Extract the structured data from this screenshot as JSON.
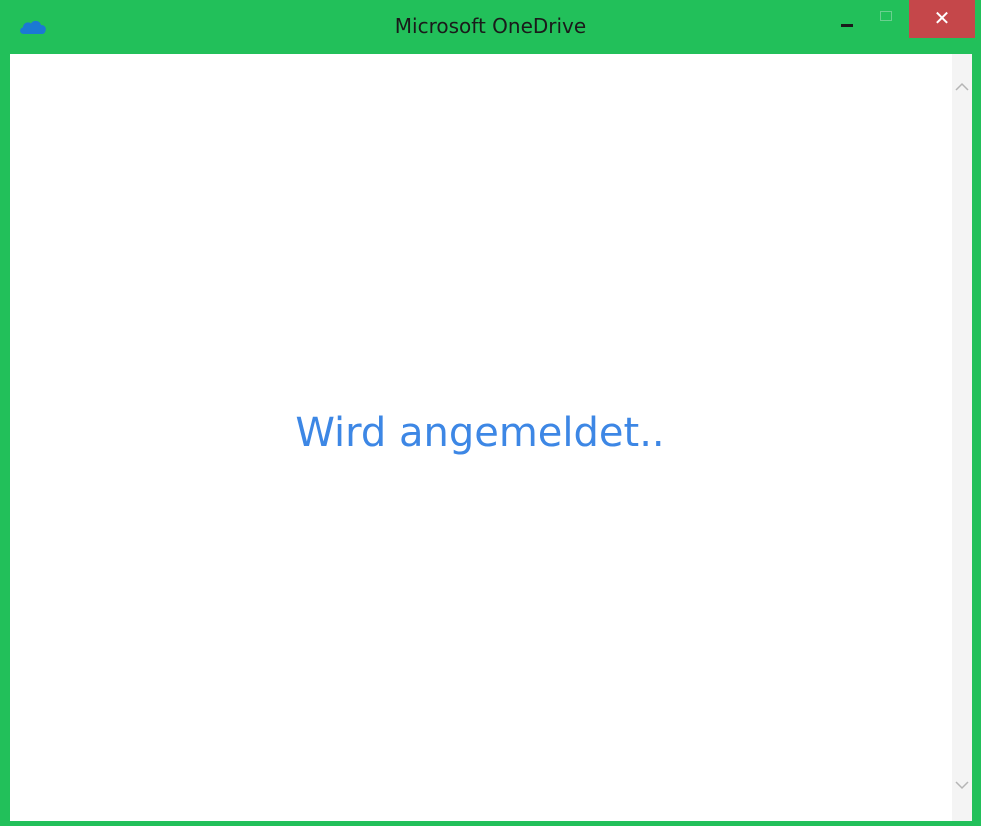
{
  "window": {
    "title": "Microsoft OneDrive",
    "app_icon": "onedrive-cloud-icon",
    "colors": {
      "frame": "#22c05a",
      "close_button": "#c5474a",
      "status_text": "#3d87e5",
      "scrollbar_track": "#f4f4f4",
      "onedrive_blue": "#1b79d4"
    },
    "controls": {
      "minimize_icon": "minimize-icon",
      "maximize_icon": "maximize-icon",
      "close_glyph": "✕"
    }
  },
  "content": {
    "status": "Wird angemeldet.."
  },
  "scrollbar": {
    "up_icon": "chevron-up-icon",
    "down_icon": "chevron-down-icon"
  }
}
